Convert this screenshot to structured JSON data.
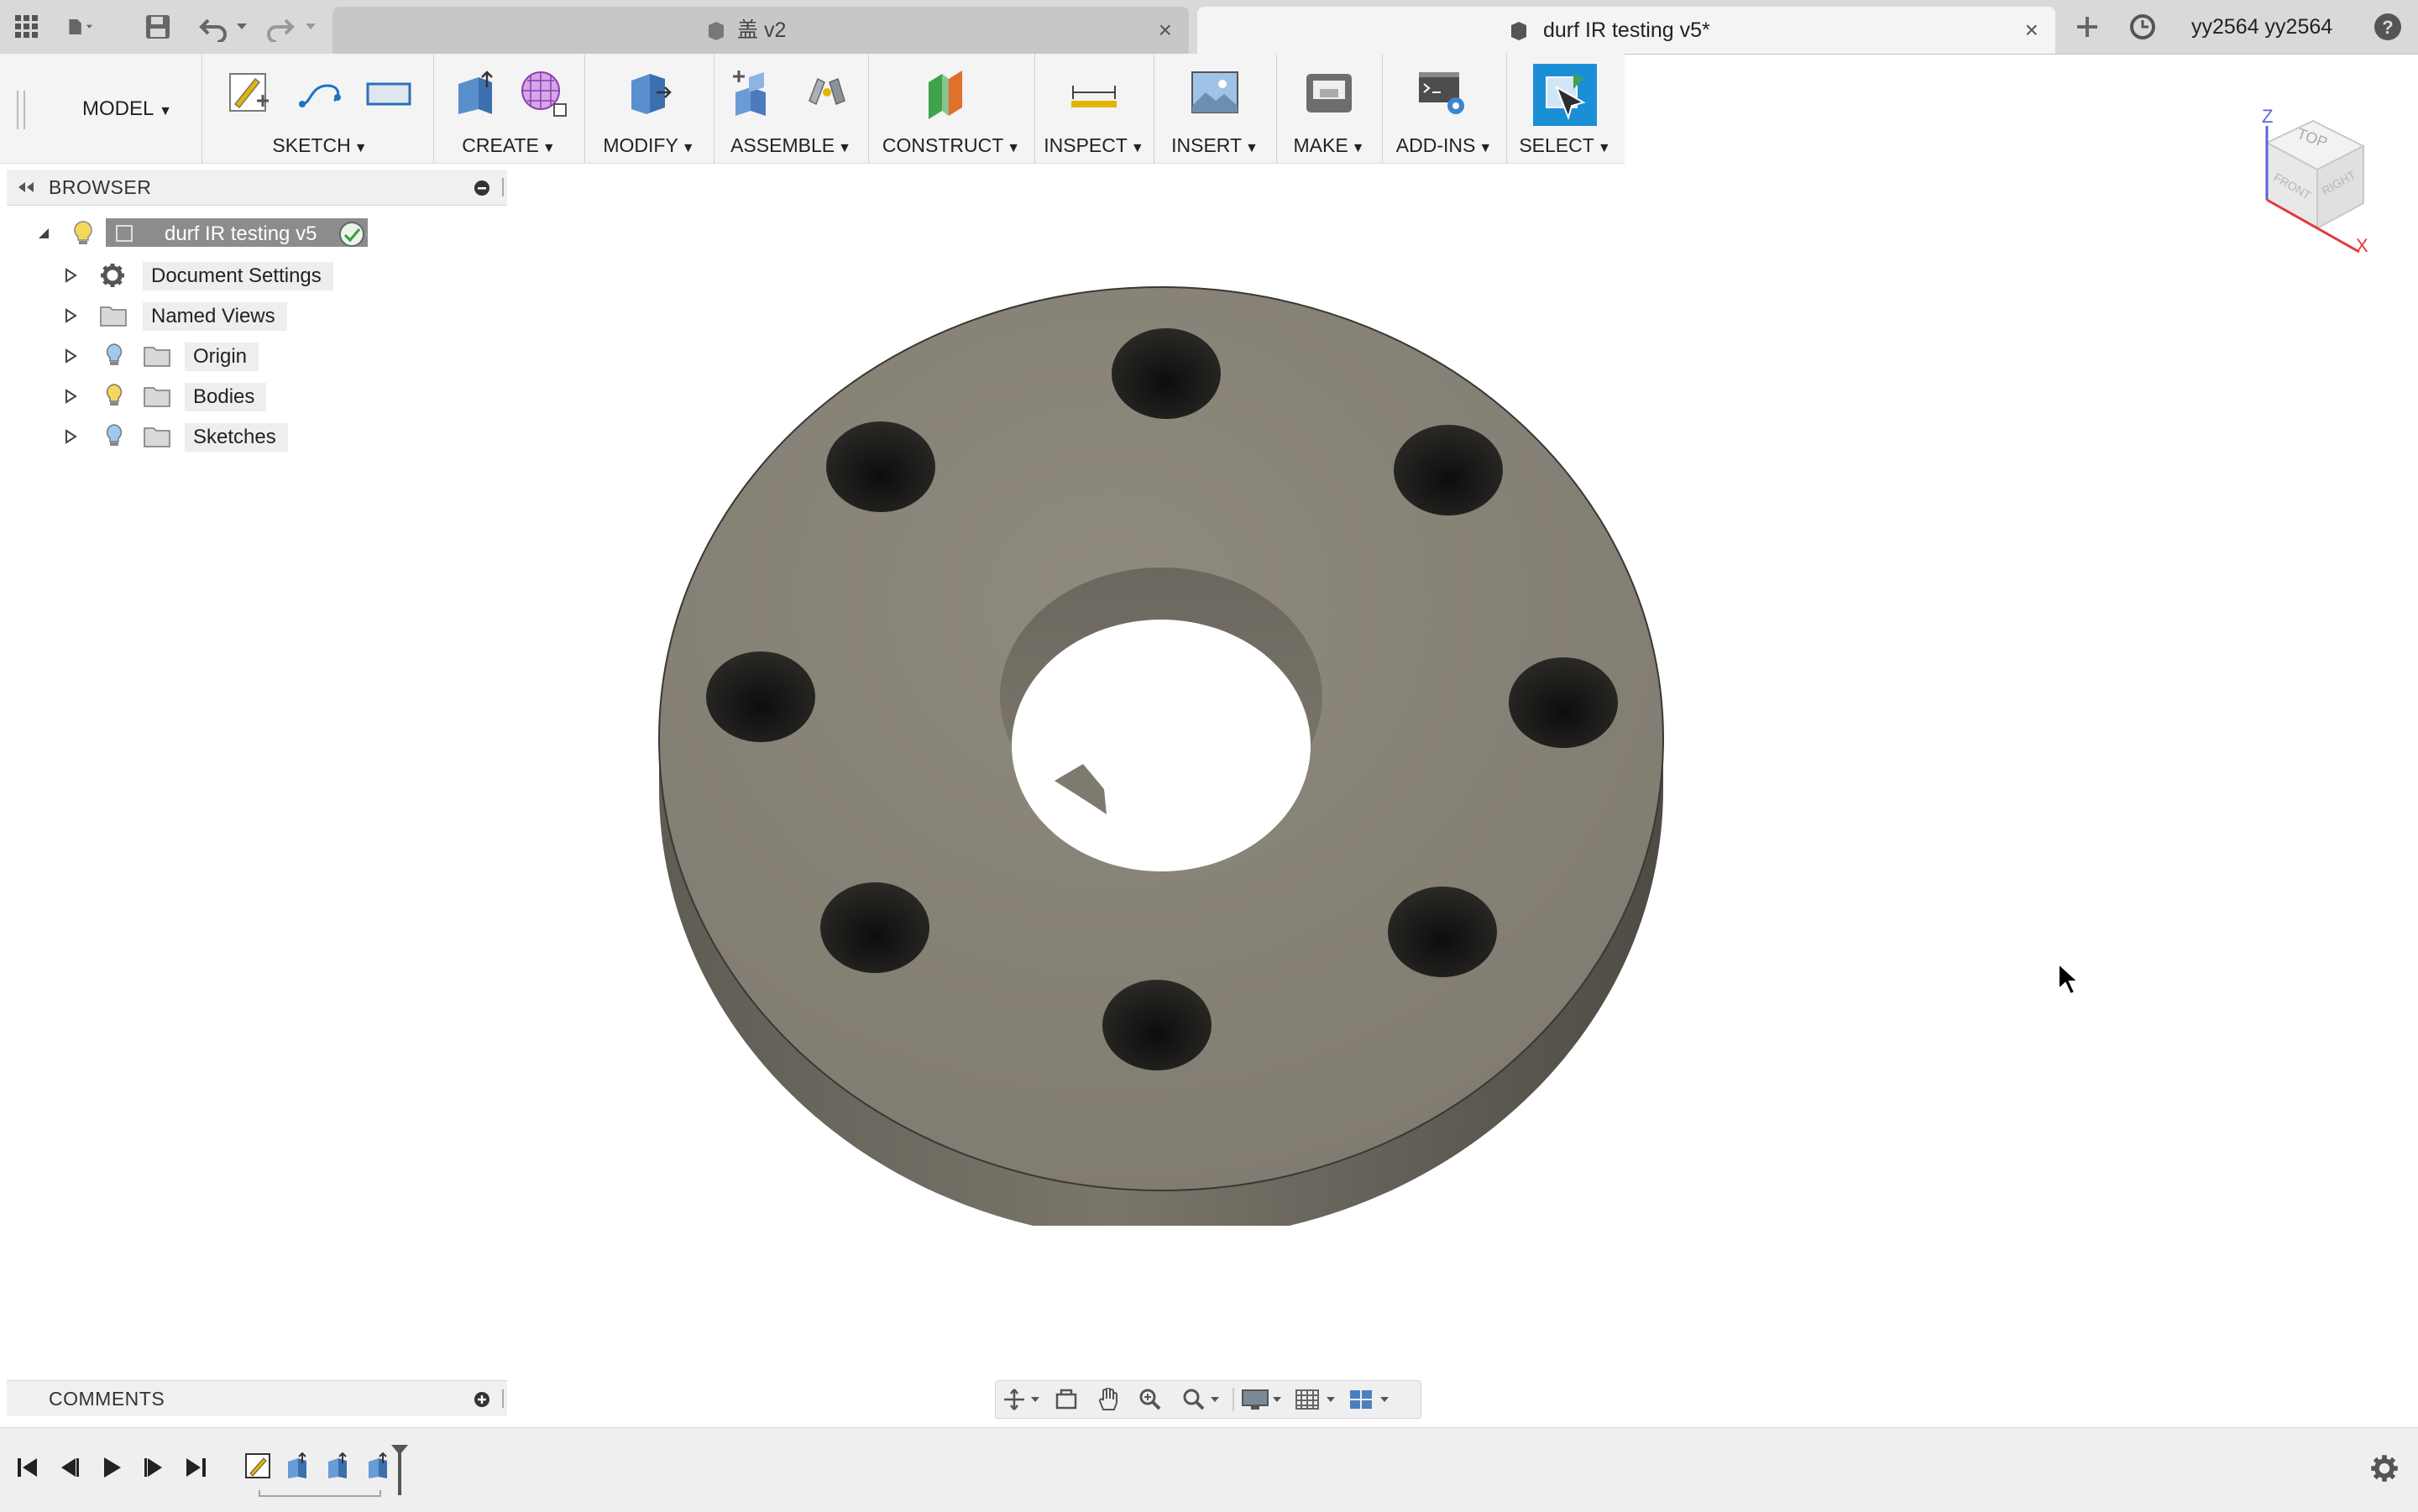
{
  "titlebar": {
    "tabs": [
      {
        "label": "盖 v2",
        "active": false
      },
      {
        "label": "durf IR testing v5*",
        "active": true
      }
    ],
    "user": "yy2564 yy2564"
  },
  "toolbar": {
    "workspace": "MODEL",
    "groups": [
      {
        "label": "SKETCH"
      },
      {
        "label": "CREATE"
      },
      {
        "label": "MODIFY"
      },
      {
        "label": "ASSEMBLE"
      },
      {
        "label": "CONSTRUCT"
      },
      {
        "label": "INSPECT"
      },
      {
        "label": "INSERT"
      },
      {
        "label": "MAKE"
      },
      {
        "label": "ADD-INS"
      },
      {
        "label": "SELECT"
      }
    ]
  },
  "browser": {
    "title": "BROWSER",
    "root": "durf IR testing v5",
    "items": [
      {
        "label": "Document Settings",
        "icon": "gear-icon"
      },
      {
        "label": "Named Views",
        "icon": "folder-icon"
      },
      {
        "label": "Origin",
        "icon": "folder-icon"
      },
      {
        "label": "Bodies",
        "icon": "folder-icon"
      },
      {
        "label": "Sketches",
        "icon": "folder-icon"
      }
    ]
  },
  "viewcube": {
    "top": "TOP",
    "front": "FRONT",
    "right": "RIGHT",
    "axis_x": "X",
    "axis_z": "Z"
  },
  "comments": {
    "title": "COMMENTS"
  },
  "colors": {
    "accent": "#1b8fd6",
    "part_top": "#8a857a",
    "part_side": "#6d695f",
    "hole": "#1c1c1a"
  }
}
